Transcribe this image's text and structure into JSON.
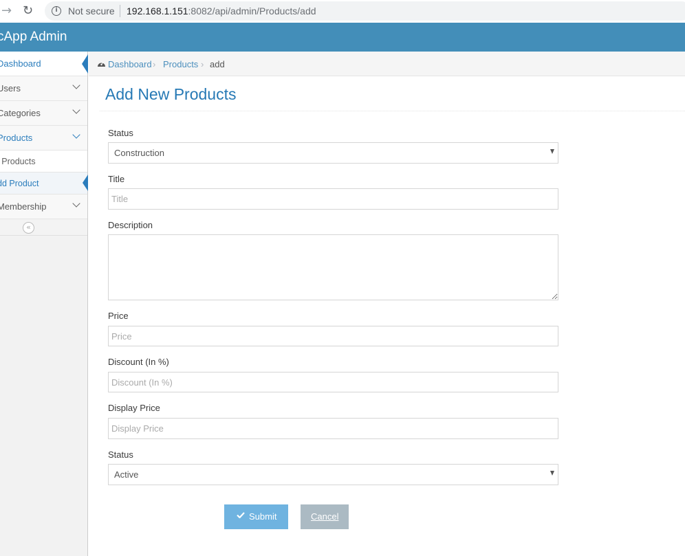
{
  "browser": {
    "security_label": "Not secure",
    "url_host": "192.168.1.151",
    "url_rest": ":8082/api/admin/Products/add"
  },
  "app": {
    "title": "cApp Admin",
    "header_color": "#438eb9"
  },
  "sidebar": {
    "items": [
      {
        "label": "Dashboard"
      },
      {
        "label": "Users"
      },
      {
        "label": "Categories"
      },
      {
        "label": "Products"
      },
      {
        "label": "l Products"
      },
      {
        "label": "dd Product"
      },
      {
        "label": "Membership"
      }
    ],
    "accent": "#2b7dbc"
  },
  "breadcrumb": {
    "items": [
      "Dashboard",
      "Products"
    ],
    "current": "add"
  },
  "page": {
    "title": "Add New Products"
  },
  "form": {
    "status_label": "Status",
    "status_value": "Construction",
    "title_label": "Title",
    "title_placeholder": "Title",
    "description_label": "Description",
    "price_label": "Price",
    "price_placeholder": "Price",
    "discount_label": "Discount (In %)",
    "discount_placeholder": "Discount (In %)",
    "display_price_label": "Display Price",
    "display_price_placeholder": "Display Price",
    "active_status_label": "Status",
    "active_status_value": "Active"
  },
  "buttons": {
    "submit": "Submit",
    "cancel": "Cancel"
  }
}
